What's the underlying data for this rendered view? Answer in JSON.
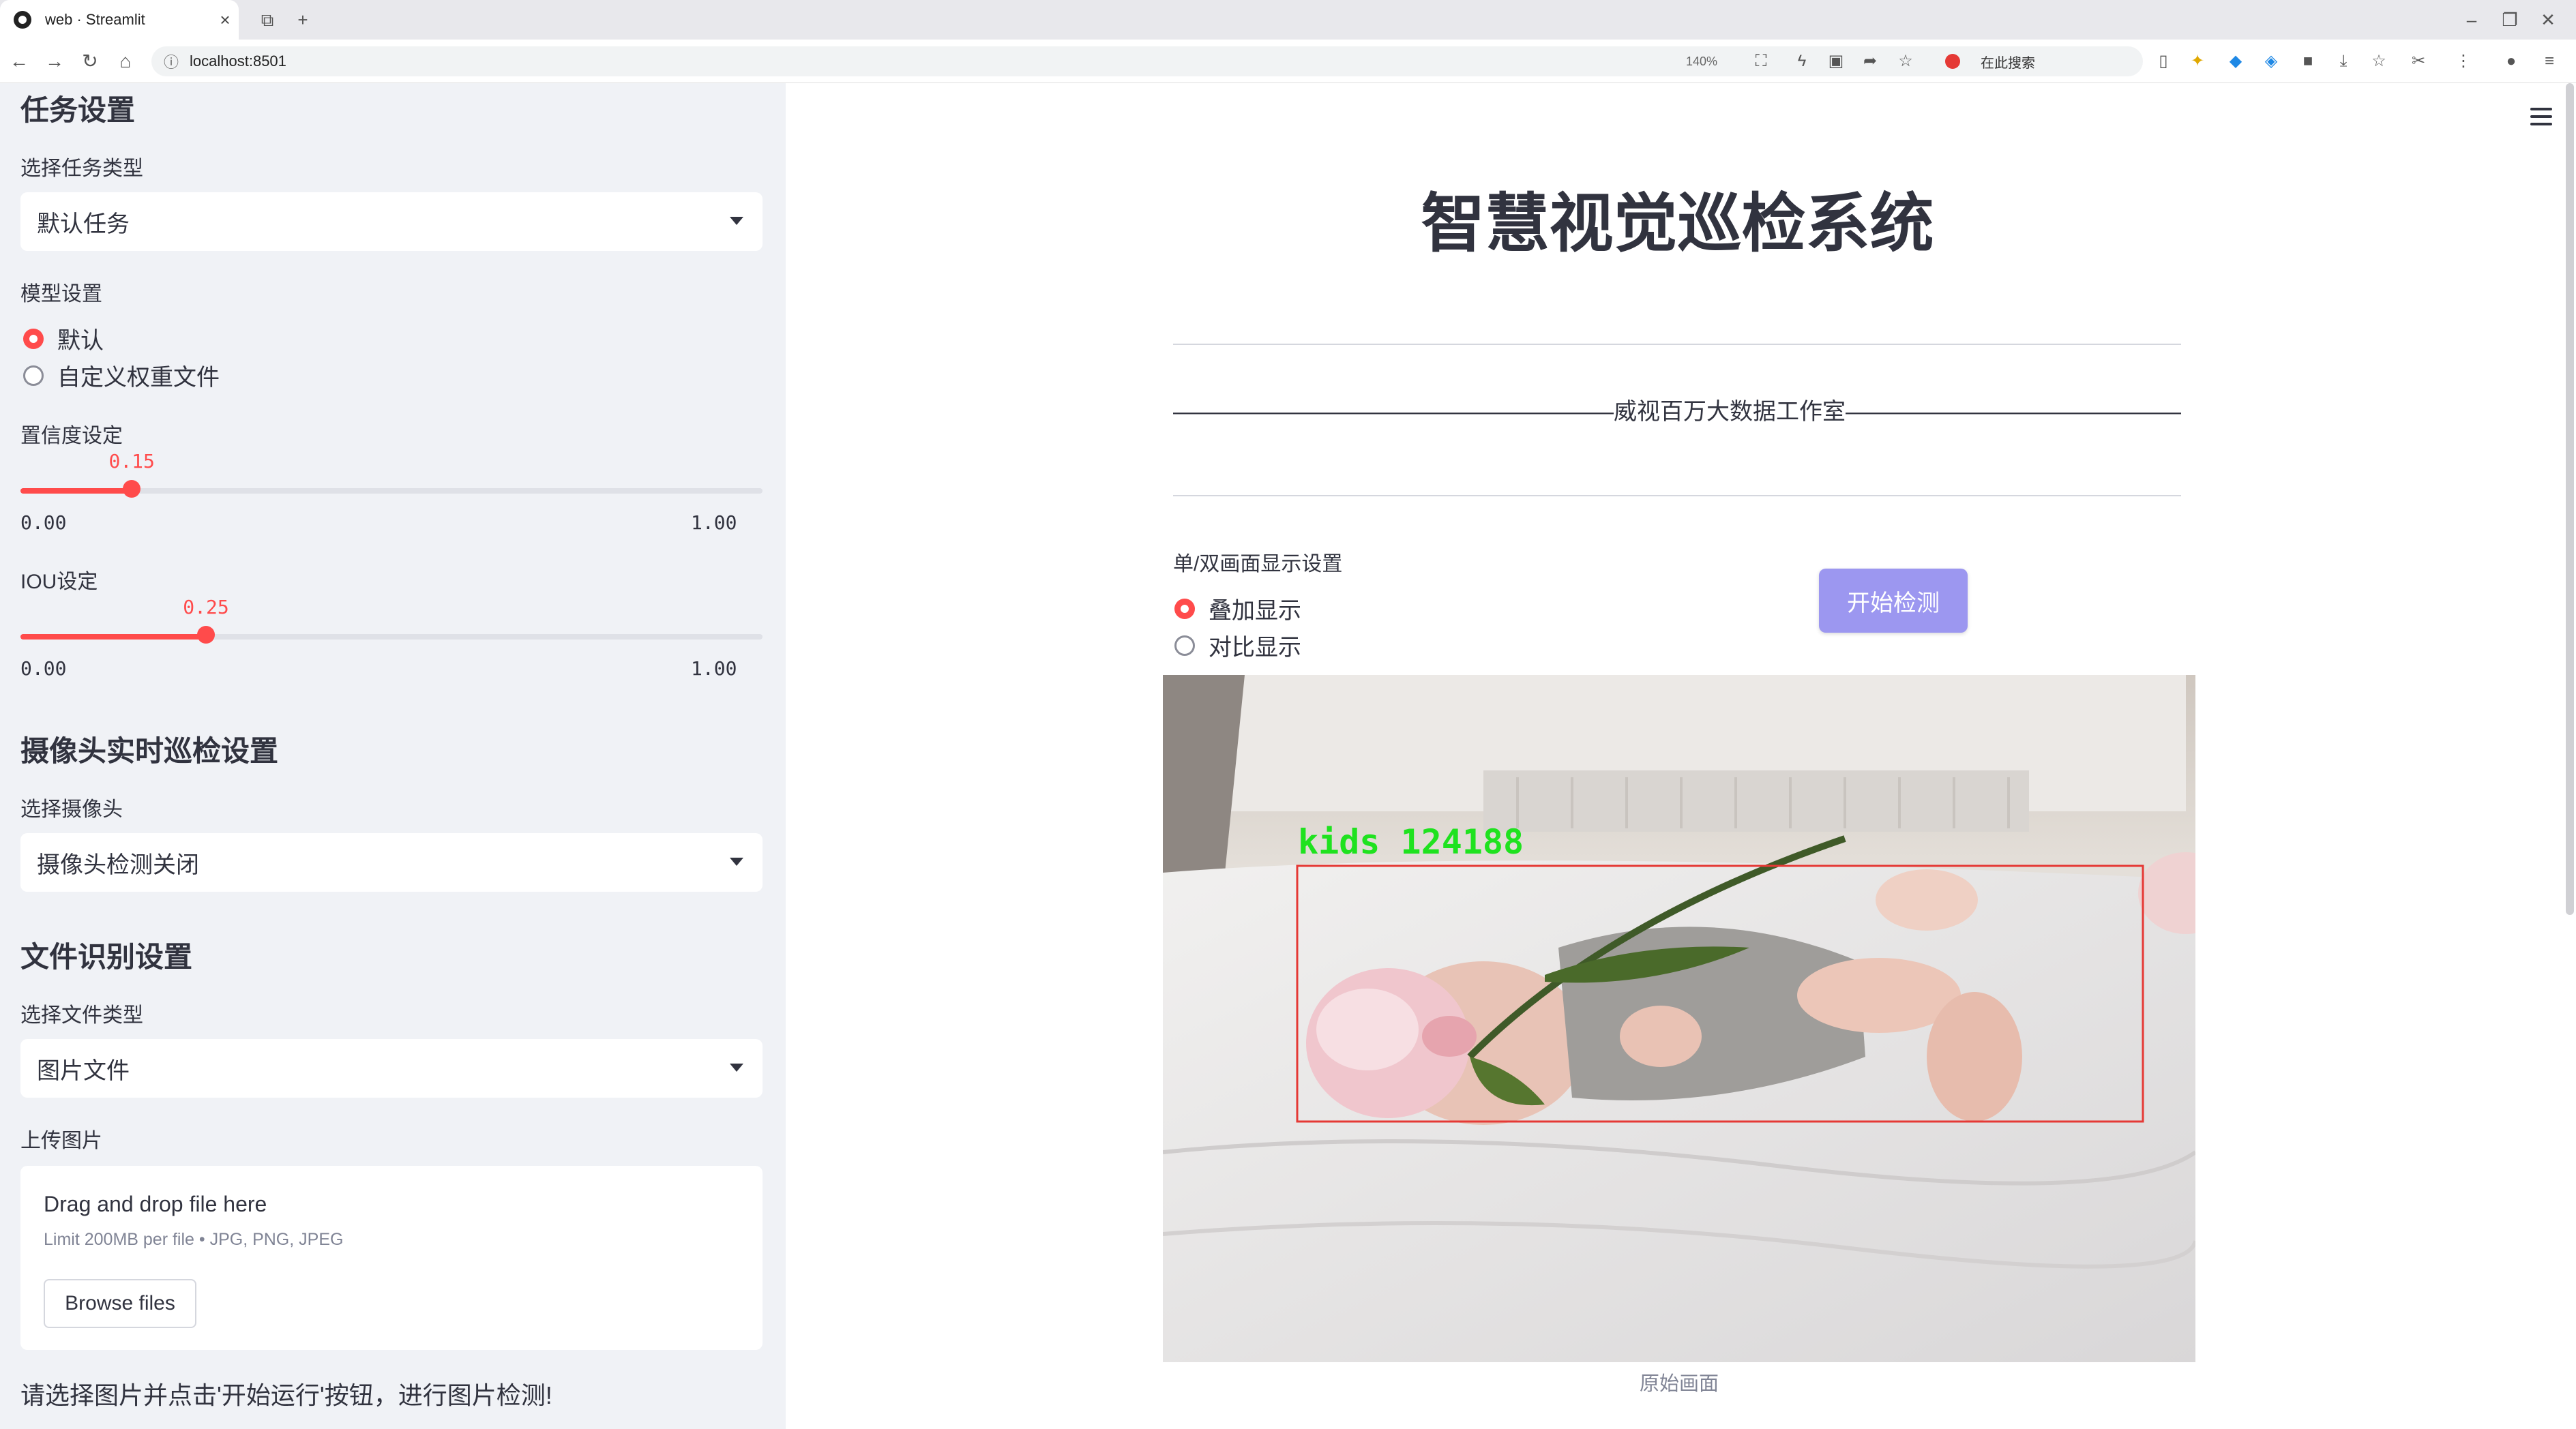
{
  "browser": {
    "tab_title": "web · Streamlit",
    "url": "localhost:8501",
    "zoom": "140%",
    "search_placeholder": "在此搜索"
  },
  "sidebar": {
    "task_section_title": "任务设置",
    "task_type_label": "选择任务类型",
    "task_type_value": "默认任务",
    "model_label": "模型设置",
    "model_options": [
      "默认",
      "自定义权重文件"
    ],
    "model_selected": "默认",
    "confidence": {
      "label": "置信度设定",
      "value": "0.15",
      "value_num": 0.15,
      "min": "0.00",
      "max": "1.00"
    },
    "iou": {
      "label": "IOU设定",
      "value": "0.25",
      "value_num": 0.25,
      "min": "0.00",
      "max": "1.00"
    },
    "camera_section_title": "摄像头实时巡检设置",
    "camera_label": "选择摄像头",
    "camera_value": "摄像头检测关闭",
    "file_section_title": "文件识别设置",
    "file_type_label": "选择文件类型",
    "file_type_value": "图片文件",
    "upload_label": "上传图片",
    "uploader": {
      "title": "Drag and drop file here",
      "limit": "Limit 200MB per file • JPG, PNG, JPEG",
      "browse_label": "Browse files"
    },
    "hint": "请选择图片并点击'开始运行'按钮，进行图片检测!"
  },
  "main": {
    "title": "智慧视觉巡检系统",
    "subtitle": "———————————————————威视百万大数据工作室———————————————————",
    "display_label": "单/双画面显示设置",
    "display_options": [
      "叠加显示",
      "对比显示"
    ],
    "display_selected": "叠加显示",
    "start_button": "开始检测",
    "detection_label": "kids 124188",
    "caption": "原始画面"
  },
  "colors": {
    "accent": "#ff4b4b",
    "start_button": "#9c97f0",
    "sidebar_bg": "#f0f2f6",
    "detection_box": "#e53935",
    "detection_text": "#1fe21f"
  }
}
